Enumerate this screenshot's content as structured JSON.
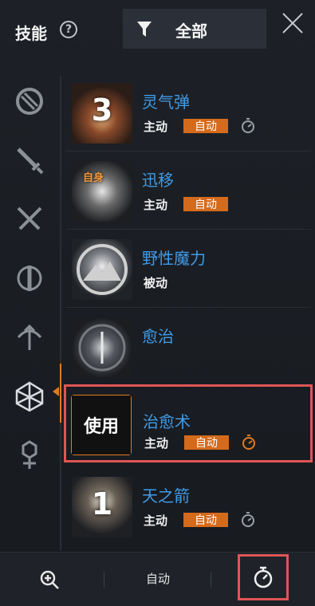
{
  "header": {
    "title": "技能",
    "help_symbol": "?",
    "filter_label": "全部"
  },
  "sidebar": {
    "categories": [
      "orb-category",
      "sword-category",
      "crossed-swords-category",
      "shield-category",
      "bow-category",
      "crystal-category",
      "totem-category"
    ],
    "selected_index": 5
  },
  "skills": [
    {
      "name": "灵气弹",
      "type": "主动",
      "auto": "自动",
      "icon_number": "3",
      "badge": "",
      "timer_highlight": false
    },
    {
      "name": "迅移",
      "type": "主动",
      "auto": "自动",
      "icon_number": "",
      "badge": "自身",
      "timer_highlight": false
    },
    {
      "name": "野性魔力",
      "type": "被动",
      "auto": "",
      "icon_number": "",
      "badge": "",
      "timer_highlight": false
    },
    {
      "name": "愈治",
      "type": "",
      "auto": "",
      "icon_number": "",
      "badge": "",
      "timer_highlight": false
    },
    {
      "name": "治愈术",
      "type": "主动",
      "auto": "自动",
      "icon_number": "",
      "badge": "使用",
      "timer_highlight": true,
      "selected": true
    },
    {
      "name": "天之箭",
      "type": "主动",
      "auto": "自动",
      "icon_number": "1",
      "badge": "",
      "timer_highlight": false
    }
  ],
  "bottom": {
    "auto_label": "自动"
  },
  "colors": {
    "accent": "#e07a20",
    "highlight": "#e05555",
    "skill_name": "#3f9be8"
  }
}
